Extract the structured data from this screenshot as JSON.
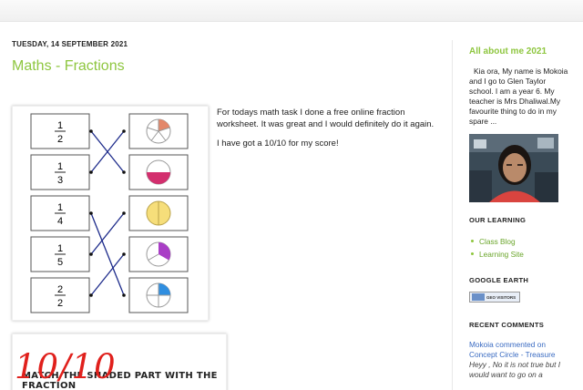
{
  "post": {
    "date": "TUESDAY, 14 SEPTEMBER 2021",
    "title": "Maths - Fractions",
    "paragraph1": "For todays math task I done a free online fraction worksheet. It was great and I would definitely do it again.",
    "paragraph2": "I have got a 10/10 for my score!",
    "worksheet": {
      "fractions": [
        {
          "num": "1",
          "den": "2"
        },
        {
          "num": "1",
          "den": "3"
        },
        {
          "num": "1",
          "den": "4"
        },
        {
          "num": "1",
          "den": "5"
        },
        {
          "num": "2",
          "den": "2"
        }
      ]
    },
    "score_image": {
      "score": "10/10",
      "caption": "MATCH THE SHADED PART WITH THE FRACTION"
    }
  },
  "sidebar": {
    "about_title": "All about me 2021",
    "about_text": "Kia ora, My name is Mokoia and I go to Glen Taylor school. I am a year 6. My teacher is Mrs Dhaliwal.My favourite thing to do in my spare ...",
    "learning_title": "OUR LEARNING",
    "learning_links": [
      "Class Blog",
      "Learning Site"
    ],
    "google_earth_title": "GOOGLE EARTH",
    "geo_badge": "GEO VISITORS",
    "recent_comments_title": "RECENT COMMENTS",
    "comment_link": "Mokoia commented on Concept Circle - Treasure",
    "comment_text": "Heyy , No it is not true but I would want to go on a"
  },
  "colors": {
    "accent_green": "#8ec63f",
    "link_blue": "#3a6bc2",
    "line_navy": "#1c2a8a"
  }
}
